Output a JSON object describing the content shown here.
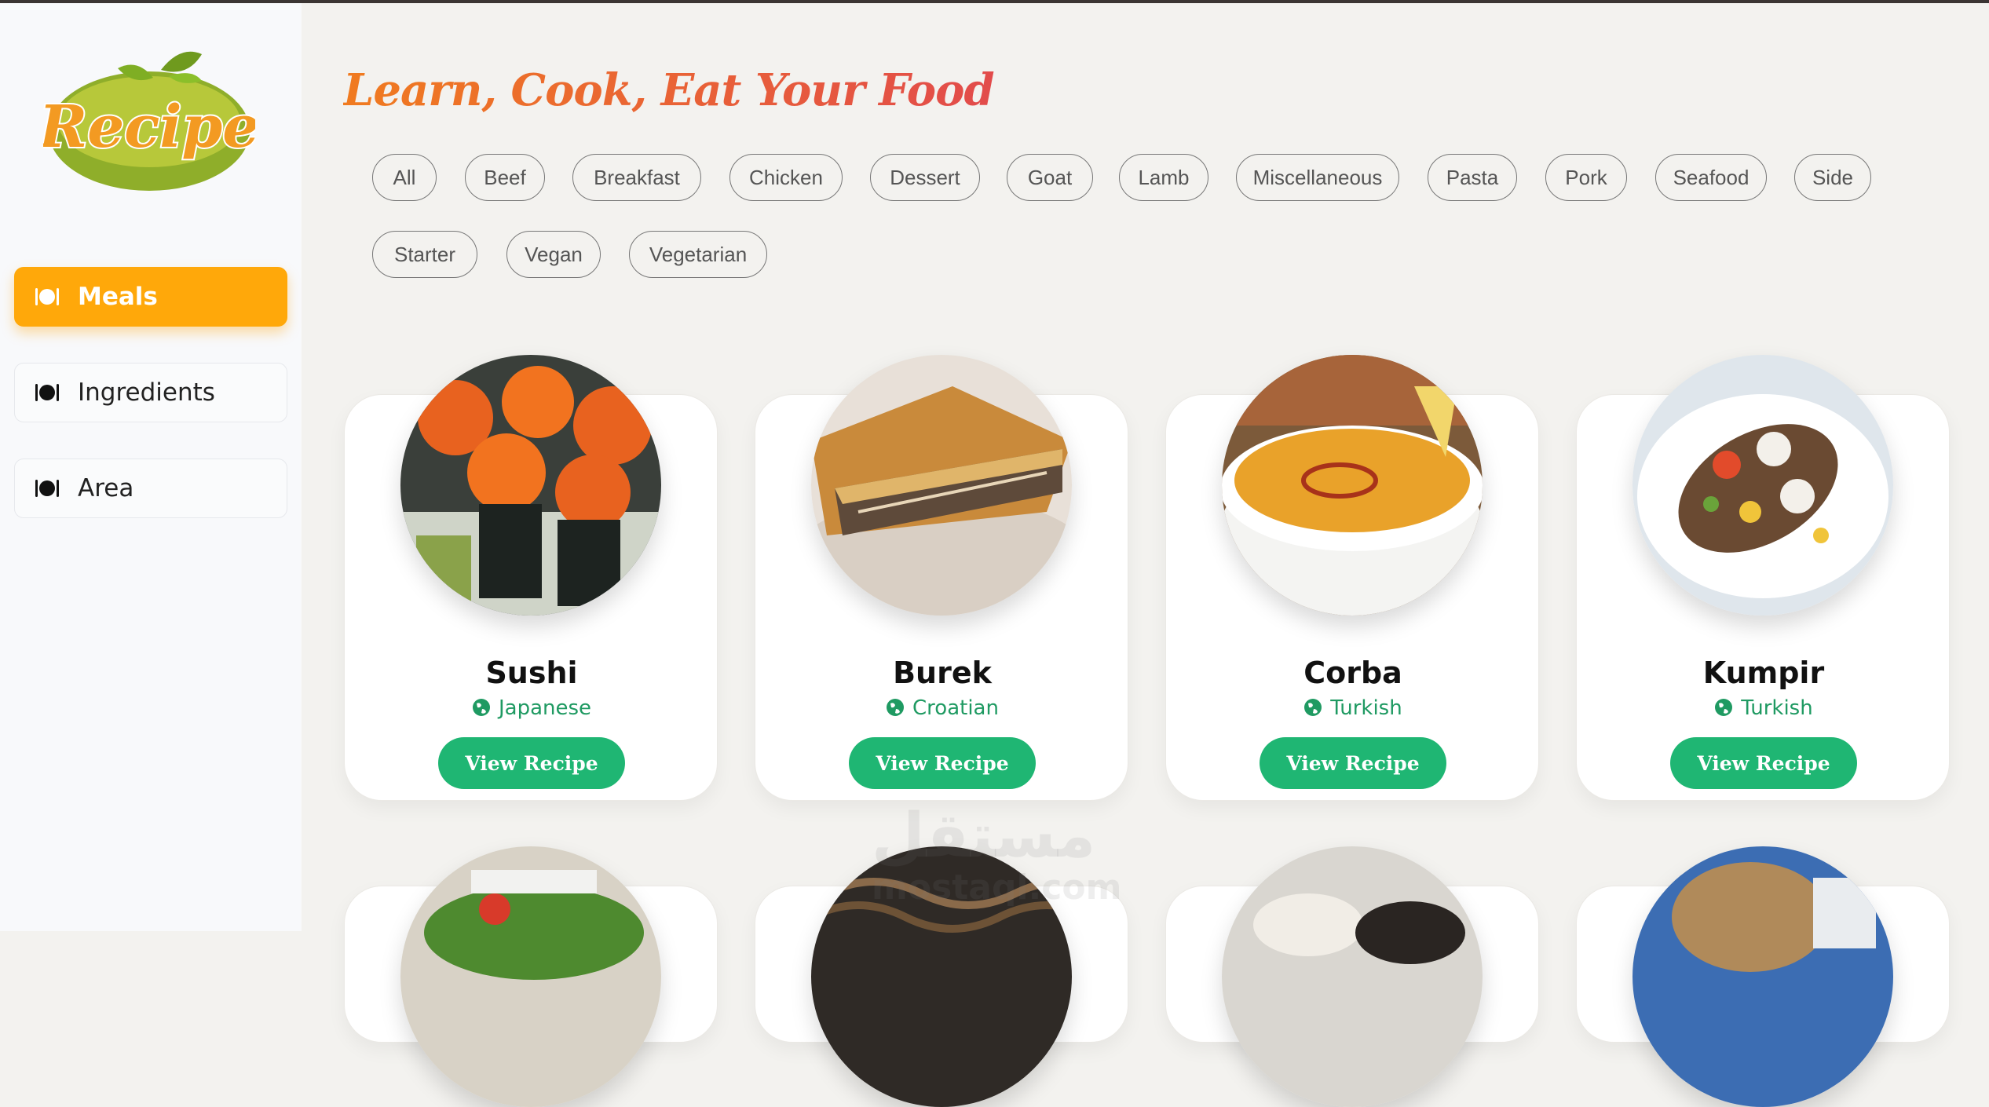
{
  "brand": {
    "logo_text": "Recipe"
  },
  "sidebar": {
    "items": [
      {
        "label": "Meals",
        "active": true
      },
      {
        "label": "Ingredients",
        "active": false
      },
      {
        "label": "Area",
        "active": false
      }
    ]
  },
  "main": {
    "headline": "Learn, Cook, Eat Your Food",
    "categories": [
      "All",
      "Beef",
      "Breakfast",
      "Chicken",
      "Dessert",
      "Goat",
      "Lamb",
      "Miscellaneous",
      "Pasta",
      "Pork",
      "Seafood",
      "Side",
      "Starter",
      "Vegan",
      "Vegetarian"
    ],
    "meals": [
      {
        "name": "Sushi",
        "area": "Japanese",
        "button": "View Recipe"
      },
      {
        "name": "Burek",
        "area": "Croatian",
        "button": "View Recipe"
      },
      {
        "name": "Corba",
        "area": "Turkish",
        "button": "View Recipe"
      },
      {
        "name": "Kumpir",
        "area": "Turkish",
        "button": "View Recipe"
      }
    ]
  },
  "watermark": {
    "text": "مستقل",
    "subtext": "mostaql.com"
  },
  "colors": {
    "accent": "#ffa80a",
    "green": "#1fb673",
    "area_text": "#1f9a62",
    "headline_start": "#f07b1f",
    "headline_end": "#e24b4b"
  }
}
